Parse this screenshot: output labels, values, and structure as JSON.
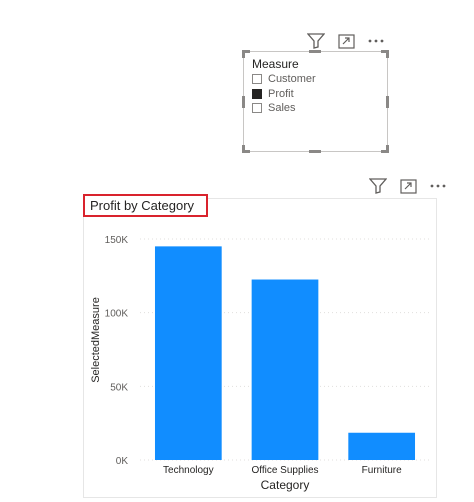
{
  "slicer": {
    "title": "Measure",
    "items": [
      {
        "label": "Customer",
        "checked": false
      },
      {
        "label": "Profit",
        "checked": true
      },
      {
        "label": "Sales",
        "checked": false
      }
    ]
  },
  "icons": {
    "filter": "filter-icon",
    "focus": "focus-mode-icon",
    "more": "more-options-icon"
  },
  "chart_data": {
    "type": "bar",
    "title": "Profit by Category",
    "xlabel": "Category",
    "ylabel": "SelectedMeasure",
    "categories": [
      "Technology",
      "Office Supplies",
      "Furniture"
    ],
    "values": [
      145000,
      122500,
      18500
    ],
    "ylim": [
      0,
      150000
    ],
    "yticks": [
      0,
      50000,
      100000,
      150000
    ],
    "ytick_labels": [
      "0K",
      "50K",
      "100K",
      "150K"
    ],
    "grid": true,
    "bar_color": "#118dff"
  },
  "colors": {
    "highlight_border": "#d9232d",
    "bar": "#118dff"
  }
}
